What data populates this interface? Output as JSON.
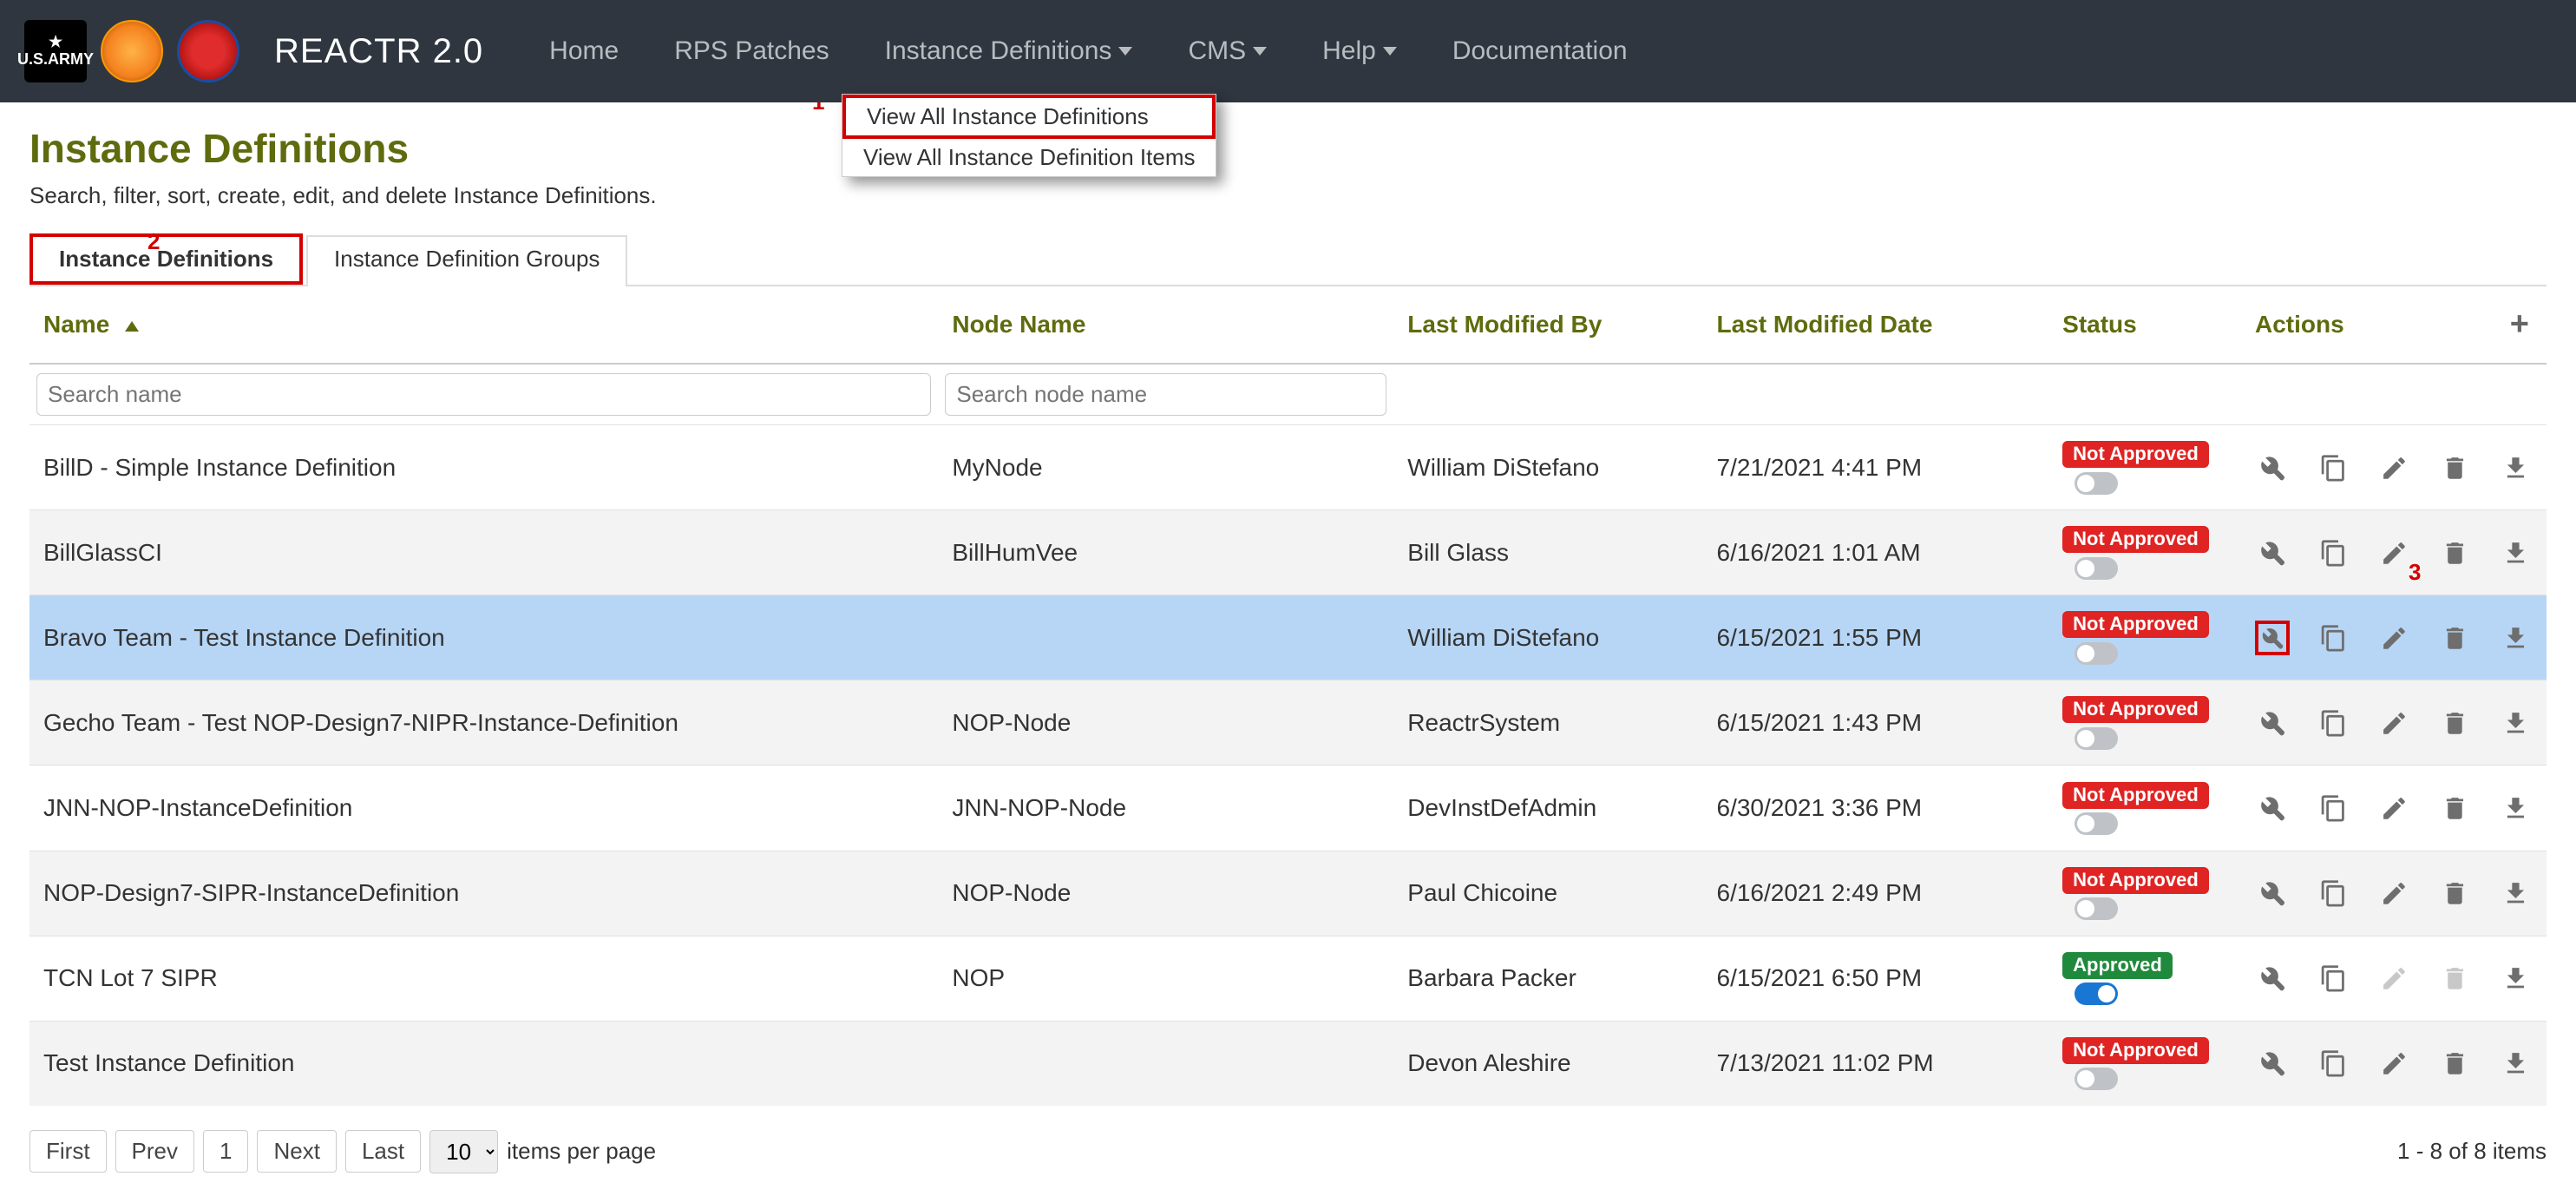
{
  "nav": {
    "brand": "REACTR 2.0",
    "items": [
      "Home",
      "RPS Patches",
      "Instance Definitions",
      "CMS",
      "Help",
      "Documentation"
    ],
    "dropdowns": [
      false,
      false,
      true,
      true,
      true,
      false
    ],
    "menu": {
      "item0": "View All Instance Definitions",
      "item1": "View All Instance Definition Items"
    }
  },
  "page": {
    "title": "Instance Definitions",
    "subtitle": "Search, filter, sort, create, edit, and delete Instance Definitions."
  },
  "tabs": {
    "t0": "Instance Definitions",
    "t1": "Instance Definition Groups"
  },
  "columns": {
    "name": "Name",
    "node": "Node Name",
    "by": "Last Modified By",
    "date": "Last Modified Date",
    "status": "Status",
    "actions": "Actions"
  },
  "filters": {
    "name_ph": "Search name",
    "node_ph": "Search node name"
  },
  "status_labels": {
    "approved": "Approved",
    "not_approved": "Not Approved"
  },
  "rows": [
    {
      "name": "BillD - Simple Instance Definition",
      "node": "MyNode",
      "by": "William DiStefano",
      "date": "7/21/2021 4:41 PM",
      "status": "not_approved",
      "toggle": false,
      "selected": false,
      "wrench_hl": false,
      "edit_disabled": false,
      "delete_disabled": false
    },
    {
      "name": "BillGlassCI",
      "node": "BillHumVee",
      "by": "Bill Glass",
      "date": "6/16/2021 1:01 AM",
      "status": "not_approved",
      "toggle": false,
      "selected": false,
      "wrench_hl": false,
      "edit_disabled": false,
      "delete_disabled": false
    },
    {
      "name": "Bravo Team - Test Instance Definition",
      "node": "",
      "by": "William DiStefano",
      "date": "6/15/2021 1:55 PM",
      "status": "not_approved",
      "toggle": false,
      "selected": true,
      "wrench_hl": true,
      "edit_disabled": false,
      "delete_disabled": false
    },
    {
      "name": "Gecho Team - Test NOP-Design7-NIPR-Instance-Definition",
      "node": "NOP-Node",
      "by": "ReactrSystem",
      "date": "6/15/2021 1:43 PM",
      "status": "not_approved",
      "toggle": false,
      "selected": false,
      "wrench_hl": false,
      "edit_disabled": false,
      "delete_disabled": false
    },
    {
      "name": "JNN-NOP-InstanceDefinition",
      "node": "JNN-NOP-Node",
      "by": "DevInstDefAdmin",
      "date": "6/30/2021 3:36 PM",
      "status": "not_approved",
      "toggle": false,
      "selected": false,
      "wrench_hl": false,
      "edit_disabled": false,
      "delete_disabled": false
    },
    {
      "name": "NOP-Design7-SIPR-InstanceDefinition",
      "node": "NOP-Node",
      "by": "Paul Chicoine",
      "date": "6/16/2021 2:49 PM",
      "status": "not_approved",
      "toggle": false,
      "selected": false,
      "wrench_hl": false,
      "edit_disabled": false,
      "delete_disabled": false
    },
    {
      "name": "TCN Lot 7 SIPR",
      "node": "NOP",
      "by": "Barbara Packer",
      "date": "6/15/2021 6:50 PM",
      "status": "approved",
      "toggle": true,
      "selected": false,
      "wrench_hl": false,
      "edit_disabled": true,
      "delete_disabled": true
    },
    {
      "name": "Test Instance Definition",
      "node": "",
      "by": "Devon Aleshire",
      "date": "7/13/2021 11:02 PM",
      "status": "not_approved",
      "toggle": false,
      "selected": false,
      "wrench_hl": false,
      "edit_disabled": false,
      "delete_disabled": false
    }
  ],
  "pager": {
    "first": "First",
    "prev": "Prev",
    "page": "1",
    "next": "Next",
    "last": "Last",
    "page_size": "10",
    "items_label": "items per page",
    "range": "1 - 8 of 8 items"
  },
  "annotations": {
    "a1": "1",
    "a2": "2",
    "a3": "3"
  }
}
